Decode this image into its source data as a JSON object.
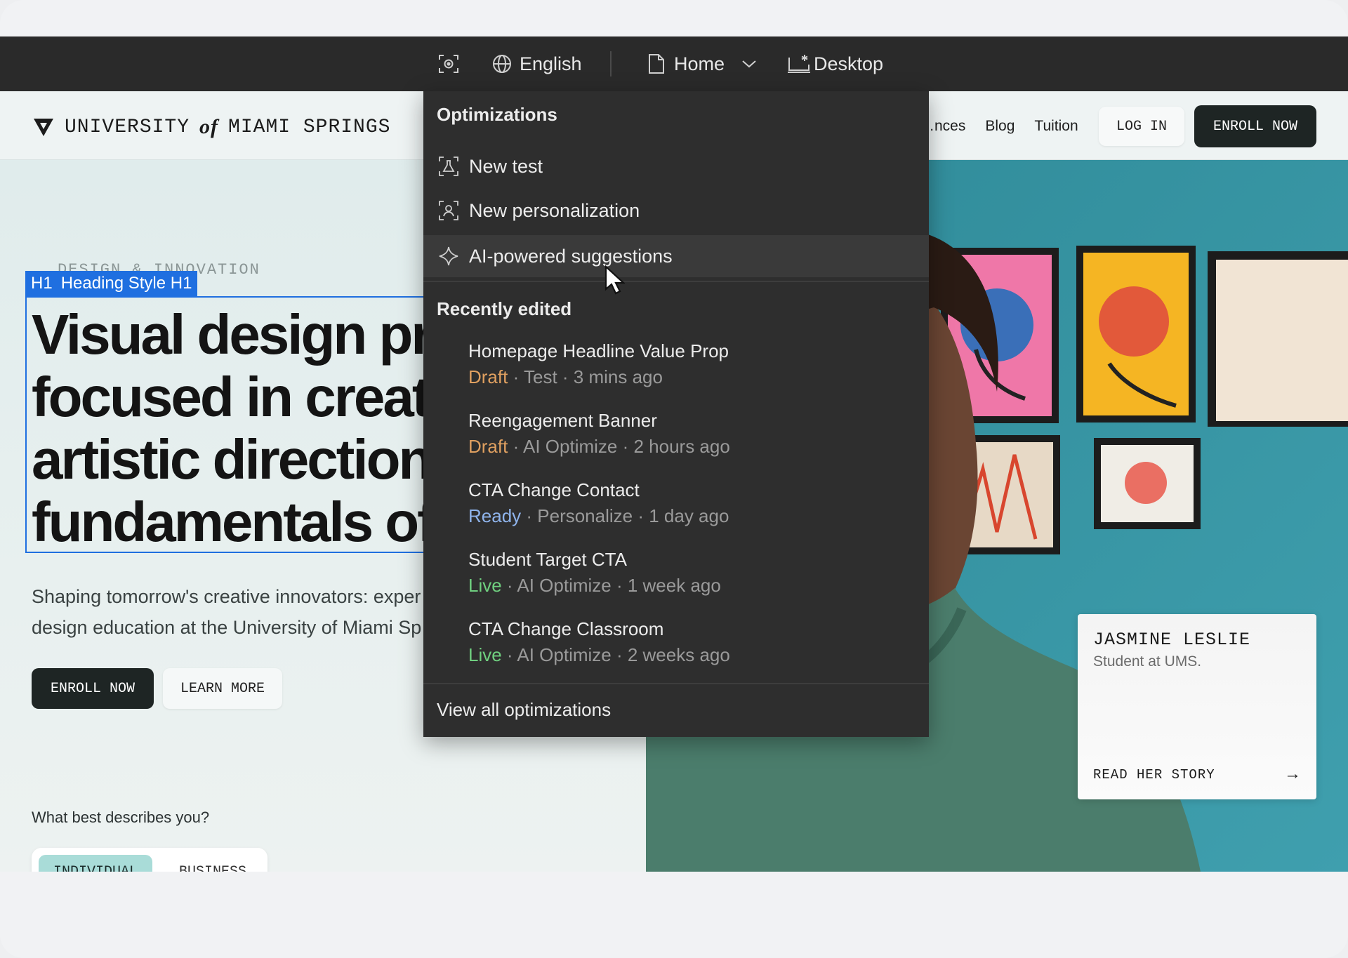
{
  "toolbar": {
    "language": "English",
    "page": "Home",
    "device": "Desktop"
  },
  "site": {
    "logo": {
      "part1": "UNIVERSITY",
      "part2": "of",
      "part3": "MIAMI SPRINGS"
    },
    "nav_links": [
      "…nces",
      "Blog",
      "Tuition"
    ],
    "login": "LOG IN",
    "enroll_top": "ENROLL NOW",
    "eyebrow": "DESIGN & INNOVATION",
    "h1_tag": {
      "tag": "H1",
      "label": "Heading Style H1"
    },
    "headline": [
      "Visual design pro",
      "focused in creati",
      "artistic direction,",
      "fundamentals of"
    ],
    "subtitle": [
      "Shaping tomorrow's creative innovators: exper",
      "design education at the University of Miami Sp"
    ],
    "enroll": "ENROLL NOW",
    "learn_more": "LEARN MORE",
    "question": "What best describes you?",
    "segment": {
      "a": "INDIVIDUAL",
      "b": "BUSINESS"
    },
    "story": {
      "name": "JASMINE LESLIE",
      "role": "Student at UMS.",
      "link": "READ HER STORY"
    }
  },
  "menu": {
    "optimizations_heading": "Optimizations",
    "items": [
      {
        "label": "New test",
        "icon": "beaker-icon"
      },
      {
        "label": "New personalization",
        "icon": "user-icon"
      },
      {
        "label": "AI-powered suggestions",
        "icon": "sparkle-icon"
      }
    ],
    "recent_heading": "Recently edited",
    "recent": [
      {
        "title": "Homepage Headline Value Prop",
        "status": "Draft",
        "status_color": "#e0a060",
        "meta": " · Test · 3 mins ago"
      },
      {
        "title": "Reengagement Banner",
        "status": "Draft",
        "status_color": "#e0a060",
        "meta": " · AI Optimize · 2 hours ago"
      },
      {
        "title": "CTA Change Contact",
        "status": "Ready",
        "status_color": "#8fb4ec",
        "meta": " · Personalize · 1 day ago"
      },
      {
        "title": "Student Target CTA",
        "status": "Live",
        "status_color": "#6fcf7f",
        "meta": " ·  AI Optimize · 1 week ago"
      },
      {
        "title": "CTA Change Classroom",
        "status": "Live",
        "status_color": "#6fcf7f",
        "meta": " · AI Optimize · 2 weeks ago"
      }
    ],
    "view_all": "View all optimizations"
  }
}
